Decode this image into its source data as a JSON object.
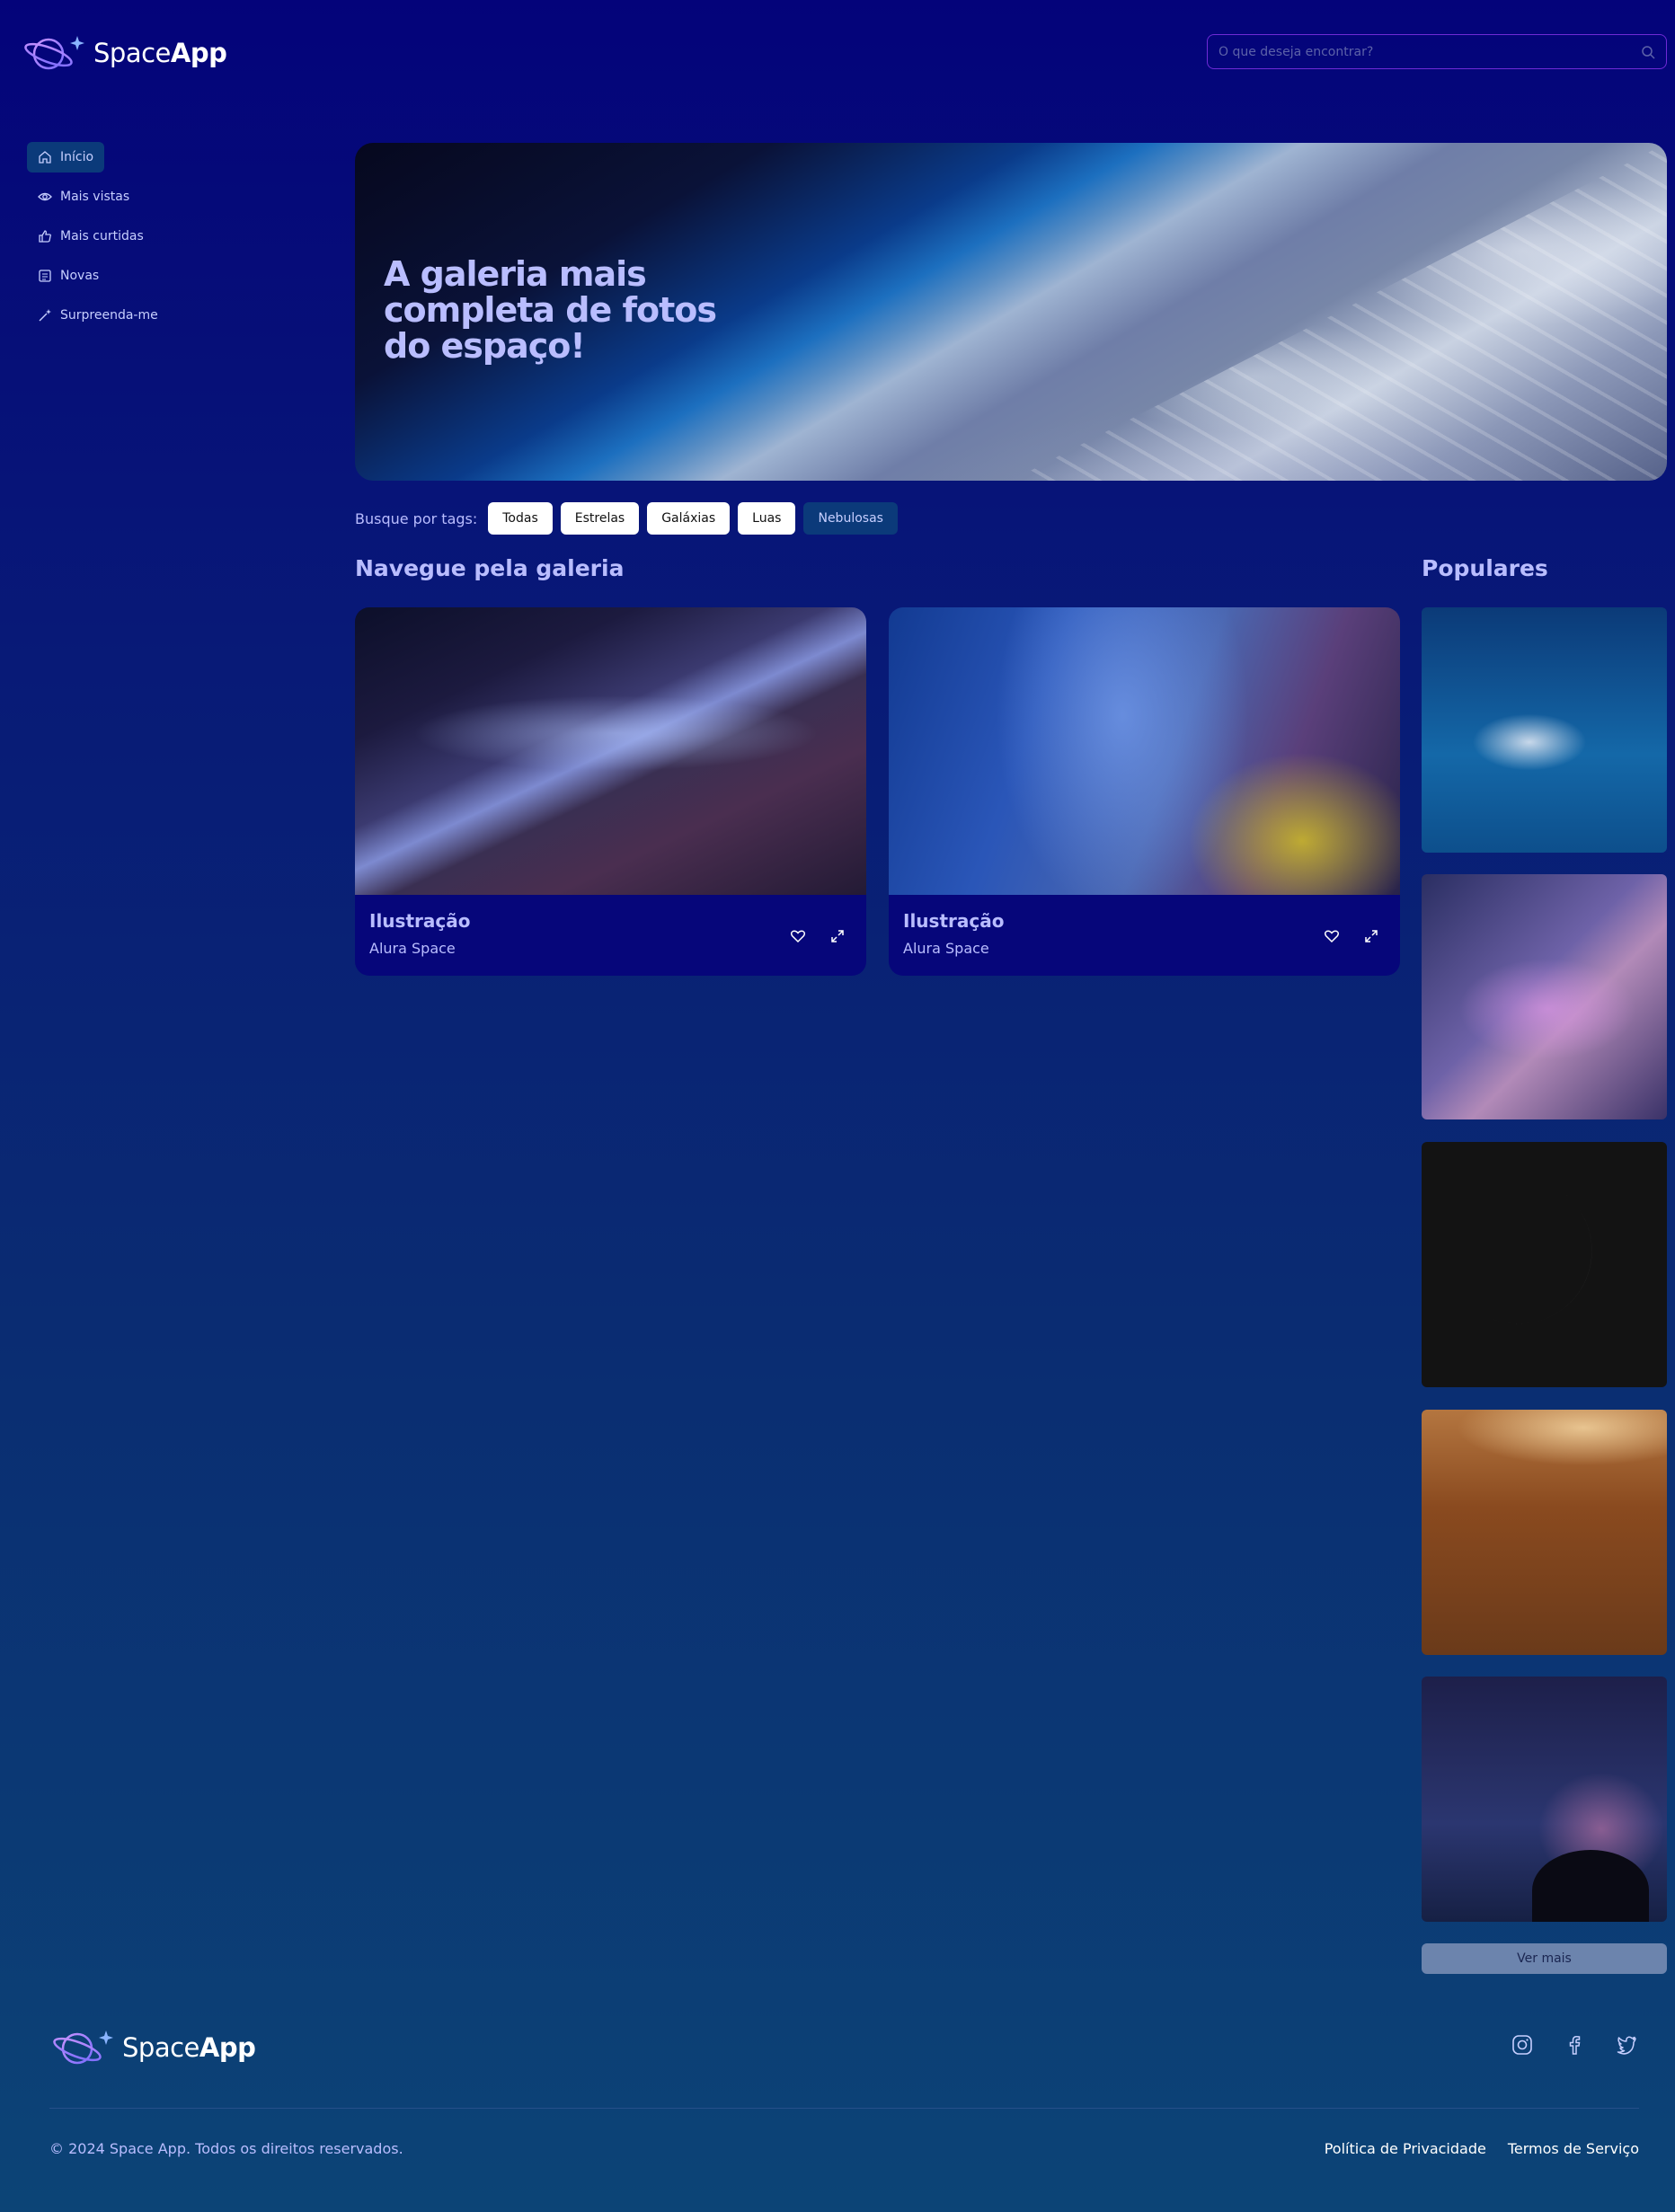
{
  "brand": {
    "name_light": "Space",
    "name_bold": "App"
  },
  "search": {
    "placeholder": "O que deseja encontrar?"
  },
  "sidebar": {
    "items": [
      {
        "label": "Início",
        "icon": "home-icon",
        "active": true
      },
      {
        "label": "Mais vistas",
        "icon": "eye-icon"
      },
      {
        "label": "Mais curtidas",
        "icon": "thumbs-up-icon"
      },
      {
        "label": "Novas",
        "icon": "newspaper-icon"
      },
      {
        "label": "Surpreenda-me",
        "icon": "sparkle-wand-icon"
      }
    ]
  },
  "hero": {
    "title": "A galeria mais completa de fotos do espaço!"
  },
  "tags": {
    "label": "Busque por tags:",
    "items": [
      "Todas",
      "Estrelas",
      "Galáxias",
      "Luas",
      "Nebulosas"
    ]
  },
  "gallery": {
    "title": "Navegue pela galeria",
    "cards": [
      {
        "title": "Ilustração",
        "author": "Alura Space"
      },
      {
        "title": "Ilustração",
        "author": "Alura Space"
      }
    ]
  },
  "popular": {
    "title": "Populares",
    "button": "Ver mais"
  },
  "footer": {
    "copyright": "© 2024 Space App. Todos os direitos reservados.",
    "links": [
      "Política de Privacidade",
      "Termos de Serviço"
    ],
    "social": [
      "instagram-icon",
      "facebook-icon",
      "twitter-icon"
    ]
  },
  "colors": {
    "background_top": "#04037a",
    "background_bottom": "#0c4476",
    "accent_text": "#b9bdff",
    "search_border": "#6f2ad6",
    "active_nav": "#0b3a7a",
    "card_bg": "#06067a",
    "button": "#6c84ad"
  }
}
